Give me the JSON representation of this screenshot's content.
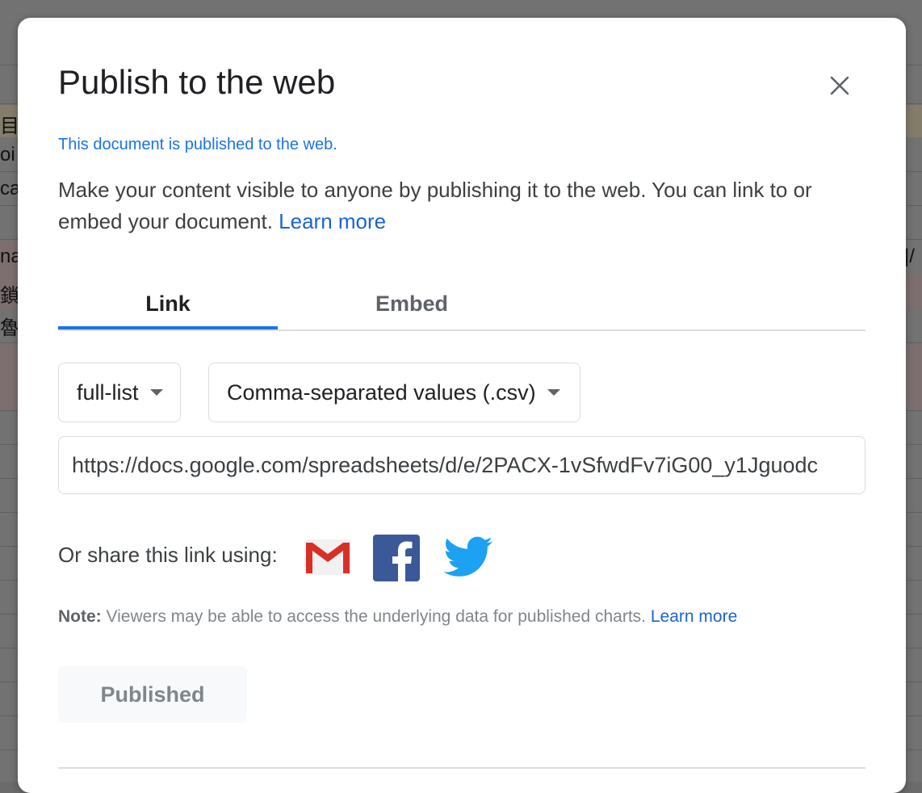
{
  "background": {
    "row_fragments": [
      "目",
      "oi",
      "ca",
      "na",
      "鎖",
      "魯"
    ],
    "right_fragment": "|/"
  },
  "dialog": {
    "title": "Publish to the web",
    "close_icon": "close-icon",
    "status": "This document is published to the web.",
    "description": "Make your content visible to anyone by publishing it to the web. You can link to or embed your document.",
    "learn_more": "Learn more",
    "tabs": [
      {
        "label": "Link",
        "active": true
      },
      {
        "label": "Embed",
        "active": false
      }
    ],
    "sheet_select": {
      "value": "full-list"
    },
    "format_select": {
      "value": "Comma-separated values (.csv)"
    },
    "url": "https://docs.google.com/spreadsheets/d/e/2PACX-1vSfwdFv7iG00_y1Jguodc",
    "share": {
      "label": "Or share this link using:",
      "services": [
        "gmail-icon",
        "facebook-icon",
        "twitter-icon"
      ]
    },
    "note": {
      "label": "Note:",
      "text": "Viewers may be able to access the underlying data for published charts.",
      "learn_more": "Learn more"
    },
    "published_button": "Published"
  },
  "colors": {
    "accent": "#1a73e8",
    "link": "#1a64d2",
    "facebook": "#3b5998",
    "twitter": "#1da1f2",
    "gmail_red": "#d93025"
  }
}
